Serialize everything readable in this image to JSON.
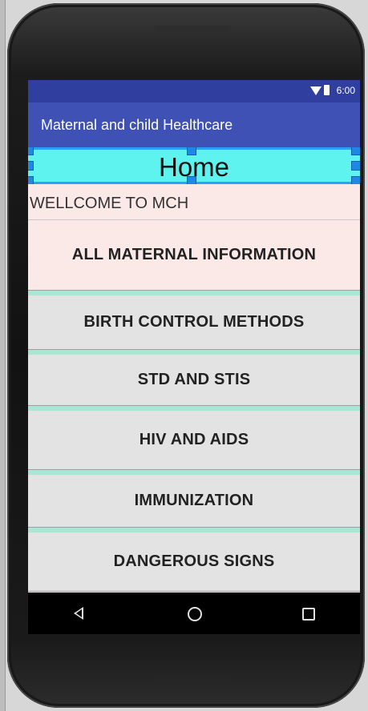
{
  "status_bar": {
    "time": "6:00",
    "icons": [
      "wifi-icon",
      "battery-icon"
    ]
  },
  "app_bar": {
    "title": "Maternal and child Healthcare"
  },
  "home": {
    "title": "Home"
  },
  "welcome": {
    "text": "WELLCOME TO MCH"
  },
  "menu": {
    "items": [
      {
        "label": "ALL MATERNAL INFORMATION"
      },
      {
        "label": "BIRTH CONTROL METHODS"
      },
      {
        "label": "STD AND STIS"
      },
      {
        "label": "HIV AND AIDS"
      },
      {
        "label": "IMMUNIZATION"
      },
      {
        "label": "DANGEROUS SIGNS"
      }
    ]
  },
  "nav_bar": {
    "icons": [
      "back-icon",
      "home-icon",
      "recents-icon"
    ]
  },
  "colors": {
    "status_bar": "#303f9f",
    "app_bar": "#3f51b5",
    "home_highlight": "#5ff3ef",
    "selection_handles": "#1e88e5",
    "content_background": "#fbe9e7",
    "menu_button": "#e3e3e3",
    "menu_separator": "#a9e6d3"
  }
}
